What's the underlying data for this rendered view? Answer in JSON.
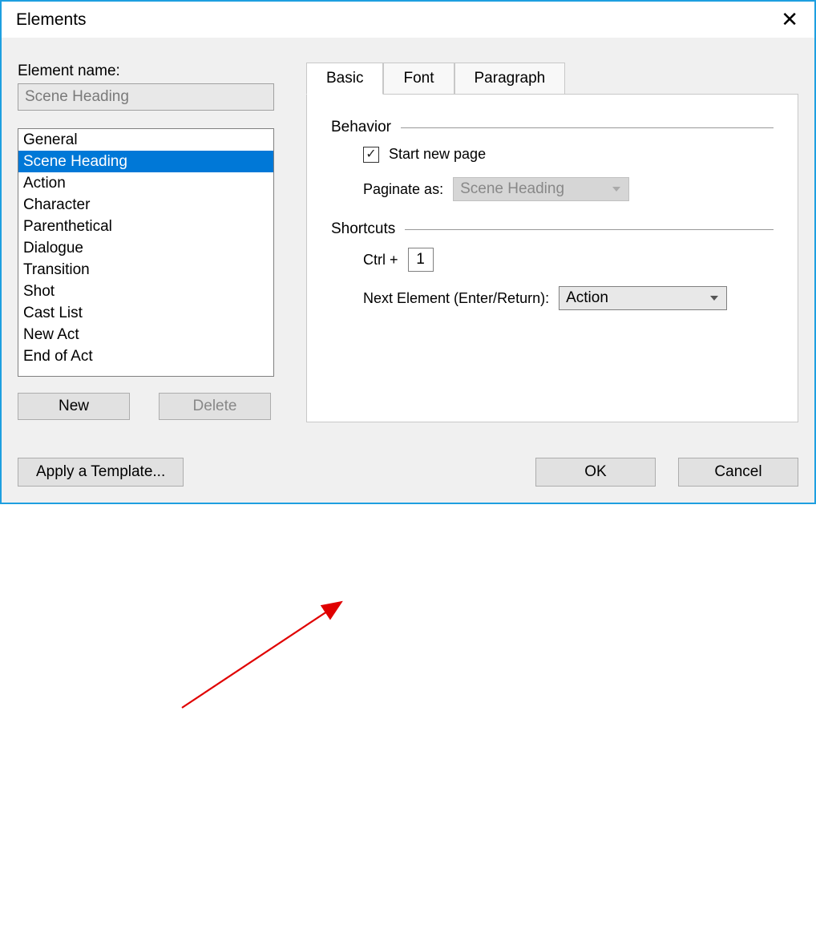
{
  "window": {
    "title": "Elements"
  },
  "left": {
    "name_label": "Element name:",
    "name_value": "Scene Heading",
    "list": [
      "General",
      "Scene Heading",
      "Action",
      "Character",
      "Parenthetical",
      "Dialogue",
      "Transition",
      "Shot",
      "Cast List",
      "New Act",
      "End of Act"
    ],
    "selected_index": 1,
    "new_btn": "New",
    "delete_btn": "Delete"
  },
  "tabs": {
    "items": [
      "Basic",
      "Font",
      "Paragraph"
    ],
    "active": 0
  },
  "basic": {
    "behavior_label": "Behavior",
    "start_new_page_label": "Start new page",
    "start_new_page_checked": true,
    "paginate_label": "Paginate as:",
    "paginate_value": "Scene Heading",
    "shortcuts_label": "Shortcuts",
    "ctrl_label": "Ctrl +",
    "ctrl_value": "1",
    "next_elem_label": "Next Element (Enter/Return):",
    "next_elem_value": "Action"
  },
  "footer": {
    "apply_template": "Apply a Template...",
    "ok": "OK",
    "cancel": "Cancel"
  }
}
